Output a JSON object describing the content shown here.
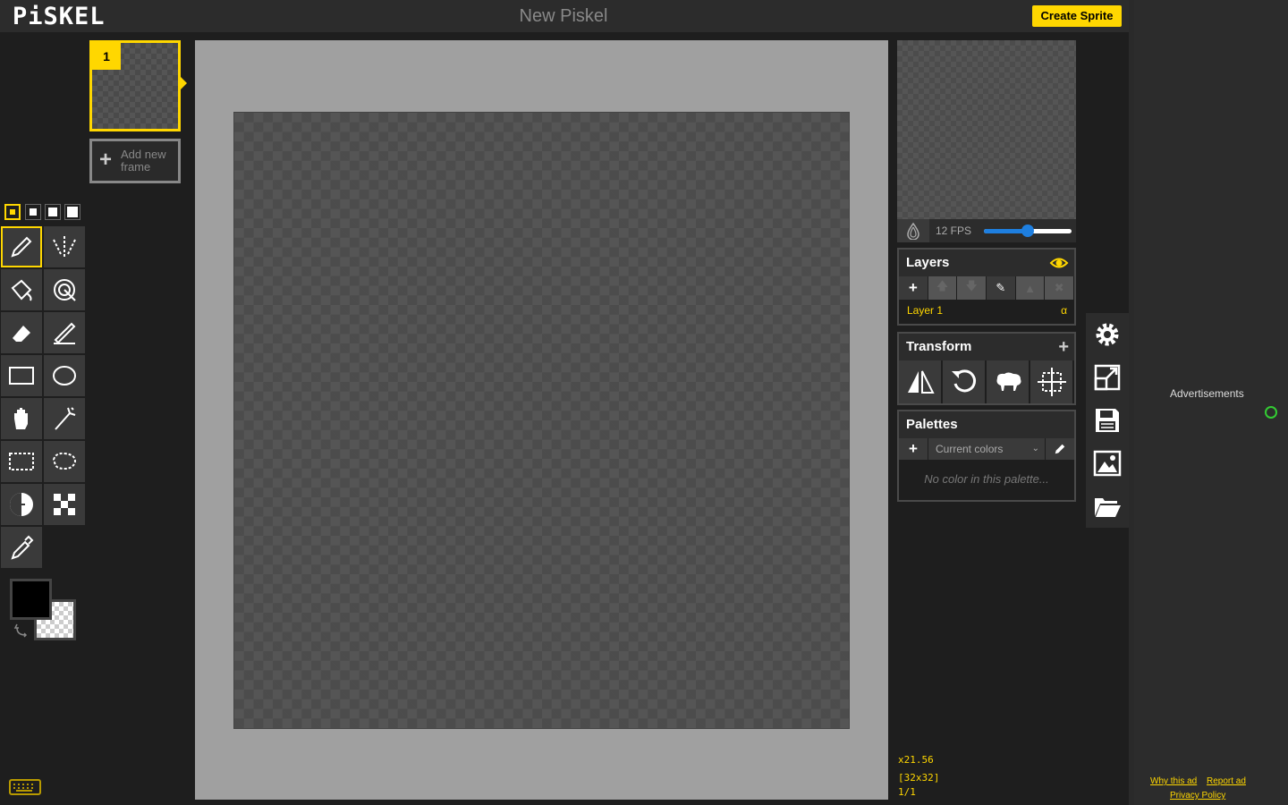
{
  "app": {
    "logo": "PiSKEL",
    "title": "New Piskel",
    "create_sprite": "Create Sprite"
  },
  "frames": {
    "items": [
      {
        "number": "1"
      }
    ],
    "add_label": "Add new frame"
  },
  "pen_sizes": [
    "1",
    "2",
    "3",
    "4"
  ],
  "tools": [
    {
      "name": "pen",
      "icon": "pen-icon"
    },
    {
      "name": "vertical-mirror-pen",
      "icon": "mirror-pen-icon"
    },
    {
      "name": "paint-bucket",
      "icon": "paint-bucket-icon"
    },
    {
      "name": "paint-all-same-color",
      "icon": "magic-bucket-icon"
    },
    {
      "name": "eraser",
      "icon": "eraser-icon"
    },
    {
      "name": "stroke",
      "icon": "stroke-icon"
    },
    {
      "name": "rectangle",
      "icon": "rectangle-icon"
    },
    {
      "name": "circle",
      "icon": "circle-icon"
    },
    {
      "name": "move",
      "icon": "hand-icon"
    },
    {
      "name": "shape-selection",
      "icon": "magic-wand-icon"
    },
    {
      "name": "rectangle-selection",
      "icon": "rect-select-icon"
    },
    {
      "name": "lasso-selection",
      "icon": "lasso-icon"
    },
    {
      "name": "lighten",
      "icon": "lighten-icon"
    },
    {
      "name": "dithering",
      "icon": "dithering-icon"
    },
    {
      "name": "color-picker",
      "icon": "eyedropper-icon"
    }
  ],
  "colors": {
    "primary": "#000000",
    "secondary": "transparent",
    "accent": "#ffd700",
    "slider": "#1e7fe0"
  },
  "preview": {
    "fps_label": "12 FPS",
    "fps_value": 12,
    "fps_max": 24
  },
  "layers": {
    "title": "Layers",
    "items": [
      {
        "name": "Layer 1",
        "alpha": "α"
      }
    ]
  },
  "transform": {
    "title": "Transform"
  },
  "palettes": {
    "title": "Palettes",
    "selected": "Current colors",
    "empty": "No color in this palette..."
  },
  "status": {
    "zoom": "x21.56",
    "size": "[32x32]",
    "frame": "1/1"
  },
  "ads": {
    "label": "Advertisements",
    "why": "Why this ad",
    "report": "Report ad",
    "privacy": "Privacy Policy"
  }
}
